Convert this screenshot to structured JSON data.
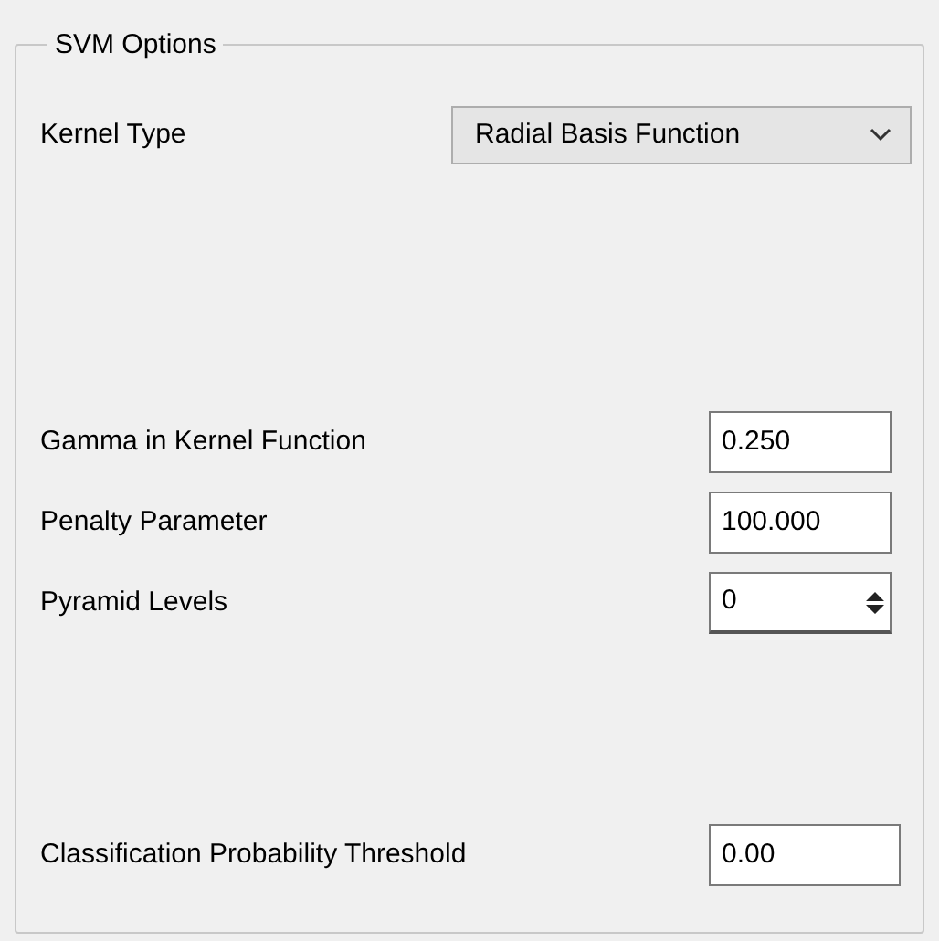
{
  "group": {
    "title": "SVM Options"
  },
  "kernel": {
    "label": "Kernel Type",
    "value": "Radial Basis Function"
  },
  "fields": [
    {
      "kind": "text",
      "label": "Gamma in Kernel Function",
      "value": "0.250"
    },
    {
      "kind": "text",
      "label": "Penalty Parameter",
      "value": "100.000"
    },
    {
      "kind": "spin",
      "label": "Pyramid Levels",
      "value": "0"
    }
  ],
  "threshold": {
    "label": "Classification Probability Threshold",
    "value": "0.00"
  }
}
